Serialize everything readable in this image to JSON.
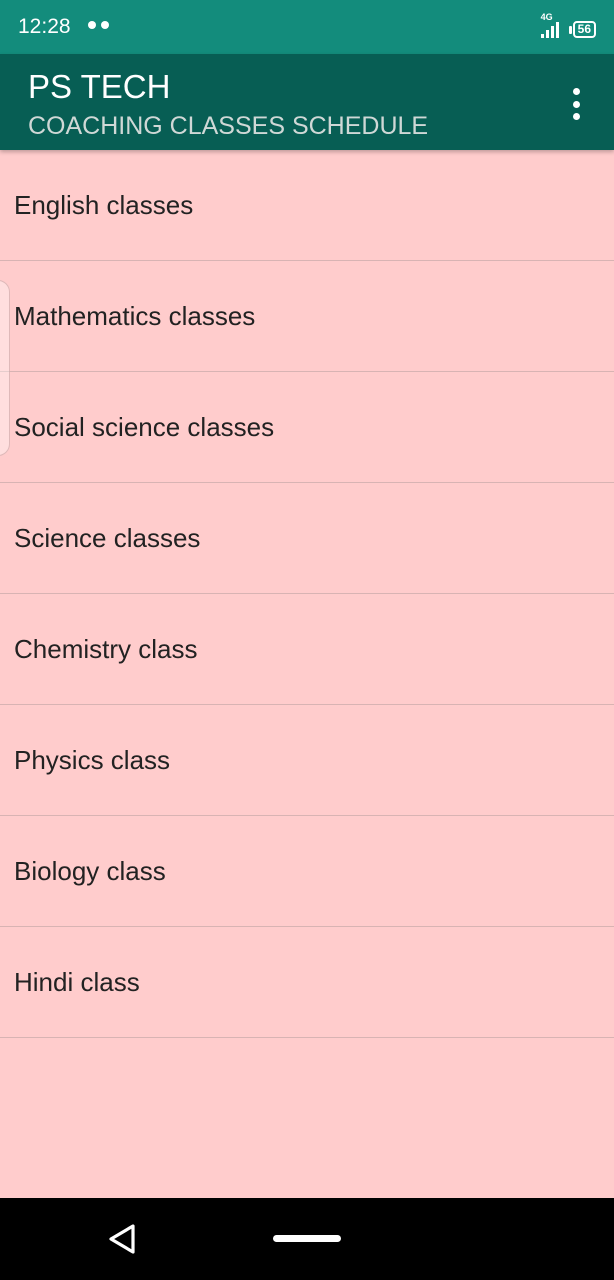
{
  "status_bar": {
    "time": "12:28",
    "network": "4G",
    "battery": "56"
  },
  "app_bar": {
    "title": "PS TECH",
    "subtitle": "COACHING CLASSES SCHEDULE",
    "menu_icon": "more-vert-icon"
  },
  "classes": [
    {
      "label": "English classes"
    },
    {
      "label": "Mathematics classes"
    },
    {
      "label": "Social science classes"
    },
    {
      "label": "Science classes"
    },
    {
      "label": "Chemistry class"
    },
    {
      "label": "Physics class"
    },
    {
      "label": "Biology class"
    },
    {
      "label": "Hindi class"
    }
  ],
  "nav_bar": {
    "back_icon": "back-triangle-icon",
    "home_icon": "home-pill-icon"
  },
  "colors": {
    "status_bar": "#138c7c",
    "app_bar": "#075e54",
    "background": "#ffcccc"
  }
}
